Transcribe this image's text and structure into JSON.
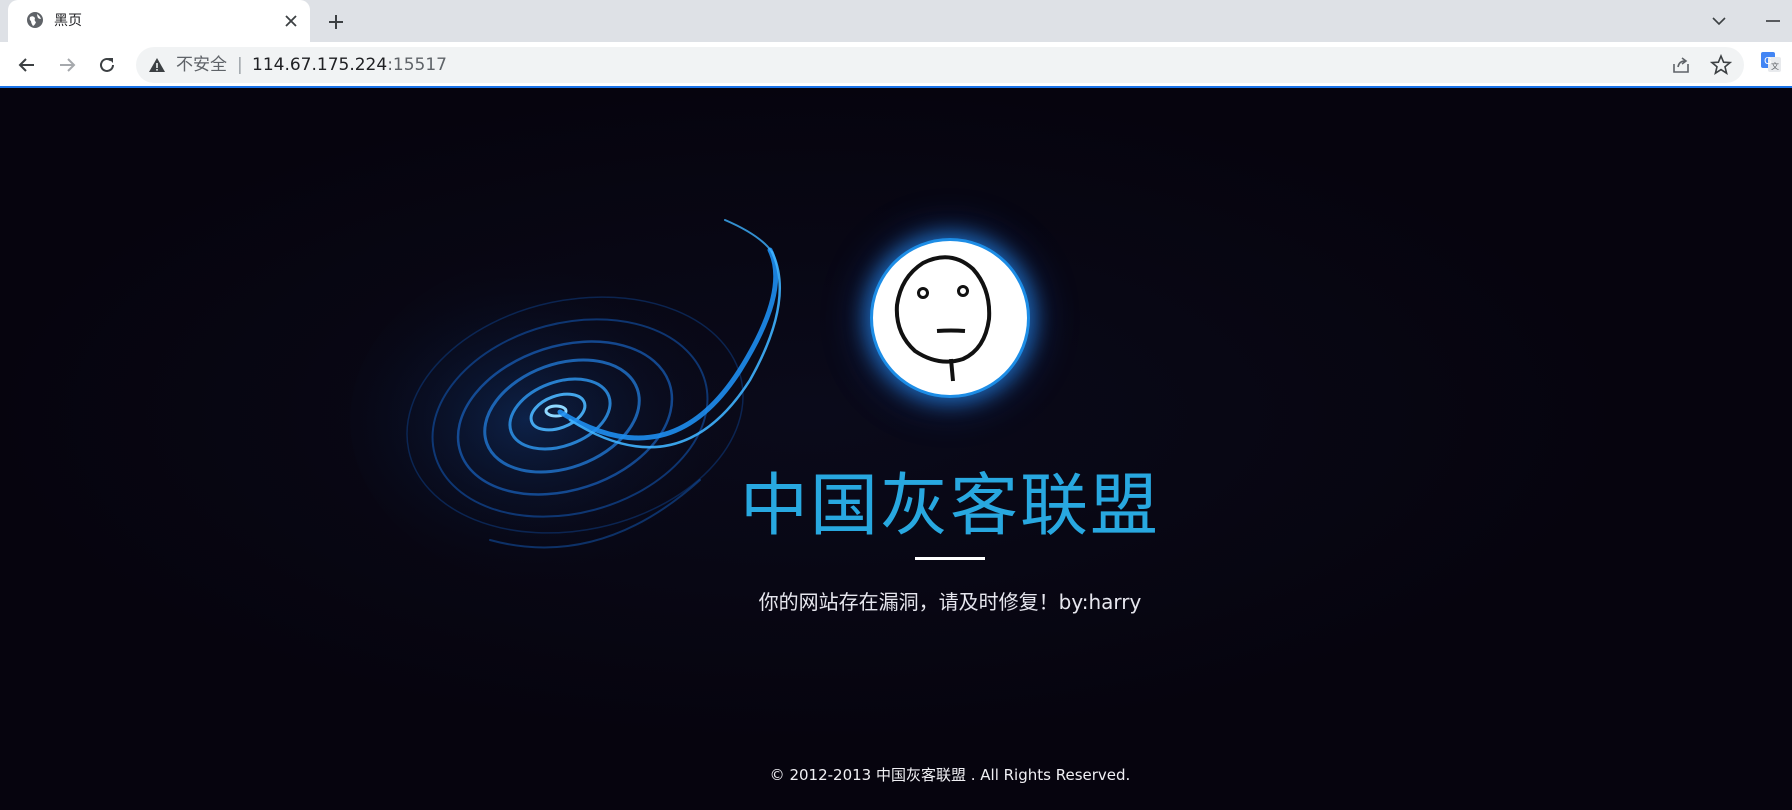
{
  "browser": {
    "tab_title": "黑页",
    "security_label": "不安全",
    "separator": "|",
    "url_host": "114.67.175.224",
    "url_port": ":15517"
  },
  "page": {
    "headline": "中国灰客联盟",
    "subtitle": "你的网站存在漏洞，请及时修复！by:harry",
    "footer": "© 2012-2013 中国灰客联盟 . All Rights Reserved."
  },
  "colors": {
    "background": "#06040e",
    "headline": "#28a8e0",
    "accent_glow": "#1d8de6"
  },
  "icons": [
    "globe-icon",
    "close-icon",
    "plus-icon",
    "chevron-down-icon",
    "minimize-icon",
    "back-arrow-icon",
    "forward-arrow-icon",
    "reload-icon",
    "warning-icon",
    "share-icon",
    "star-icon",
    "translate-icon",
    "swirl-graphic",
    "meme-face"
  ]
}
